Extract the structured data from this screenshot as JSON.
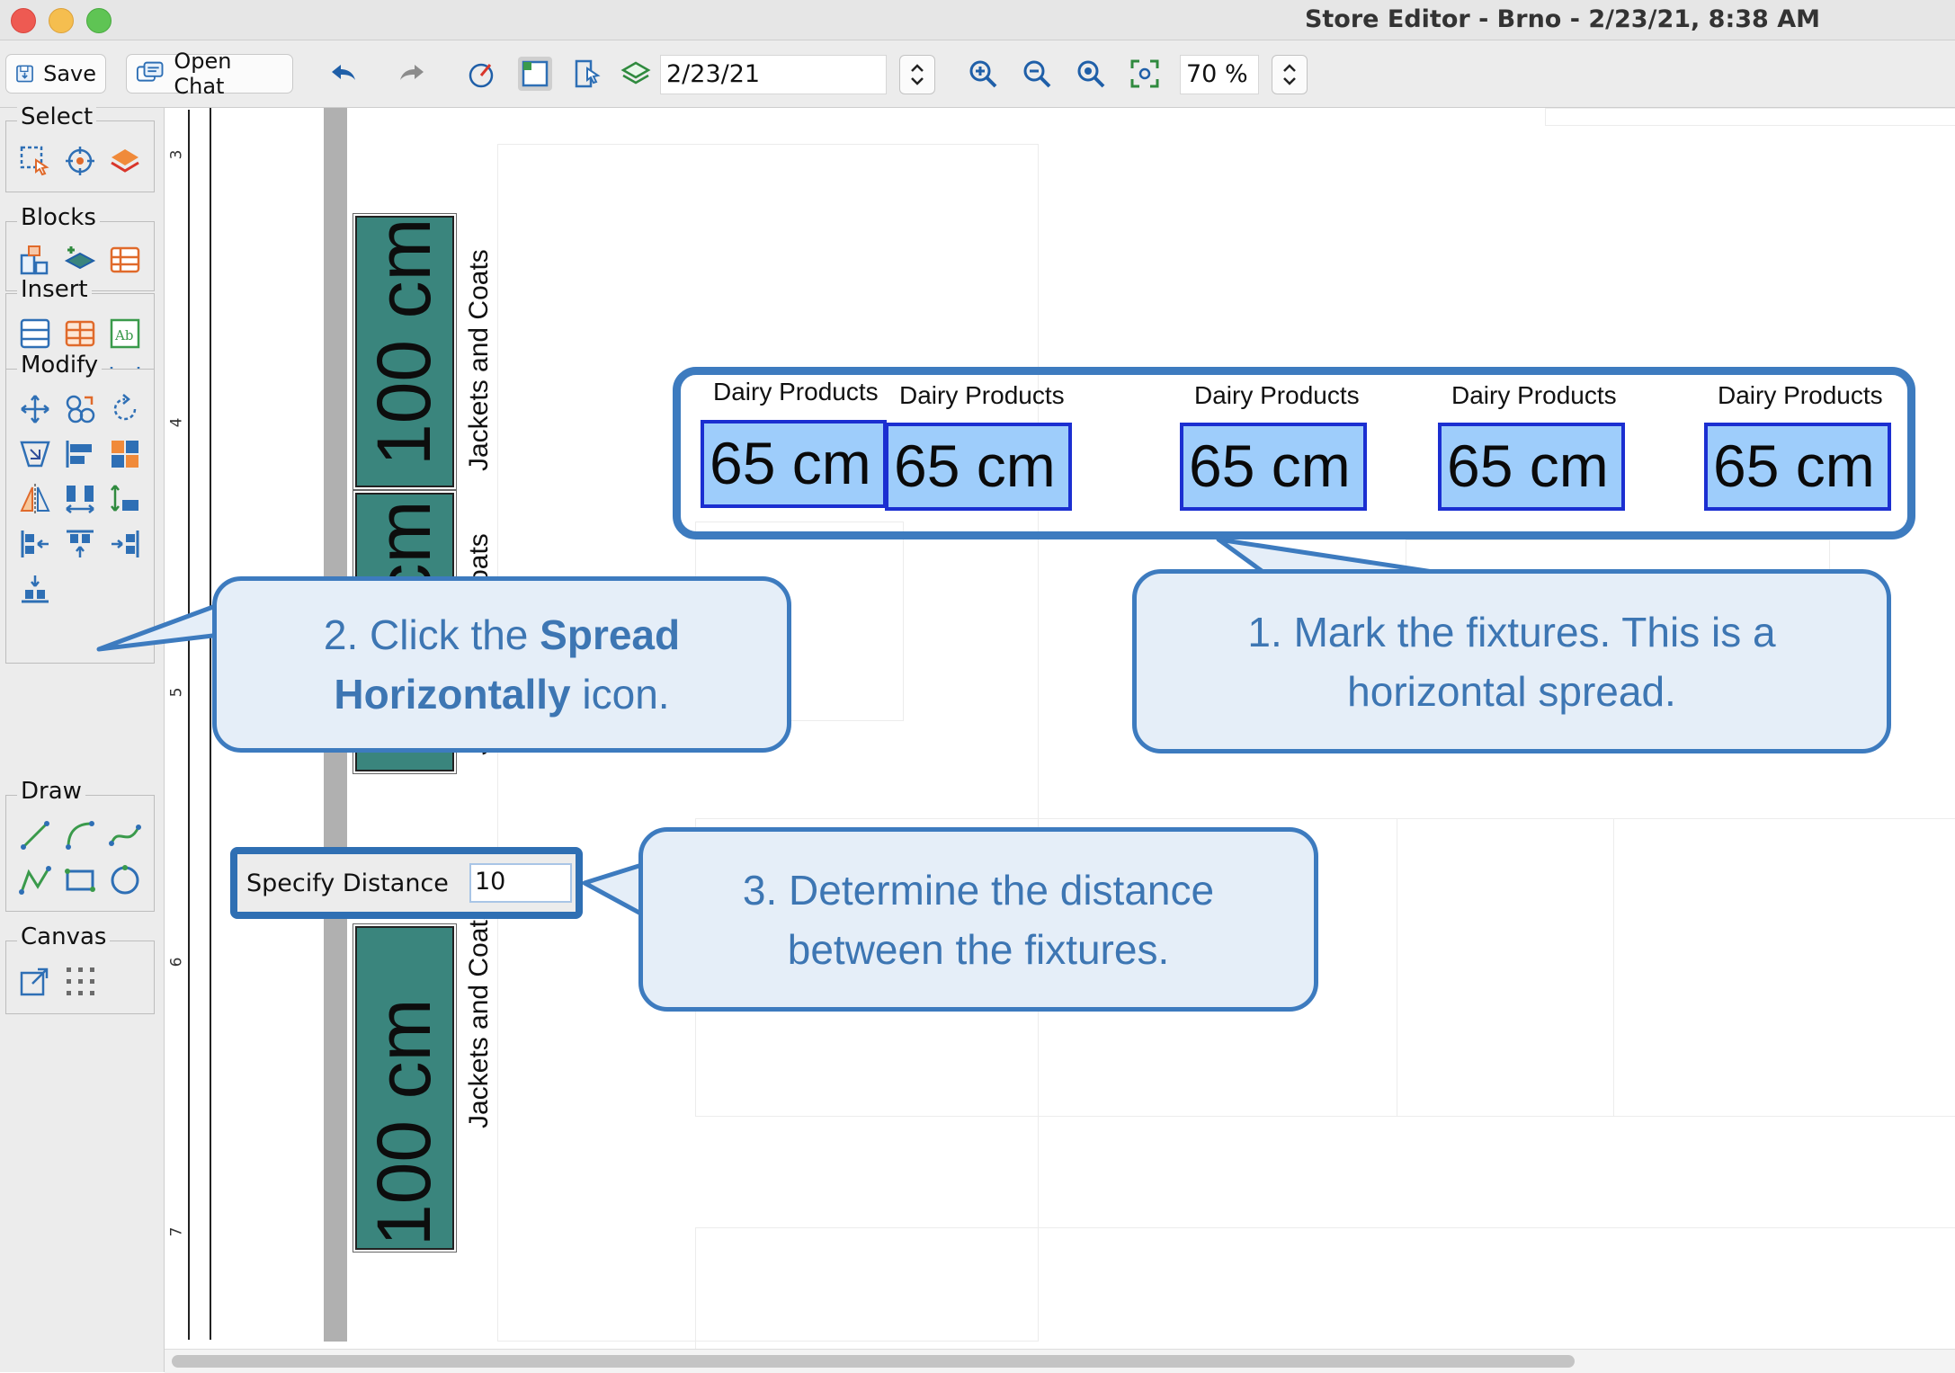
{
  "window": {
    "title": "Store Editor - Brno - 2/23/21, 8:38 AM"
  },
  "toolbar": {
    "save_label": "Save",
    "open_chat_label": "Open Chat",
    "date_value": "2/23/21",
    "zoom_value": "70 %"
  },
  "palette": {
    "select_label": "Select",
    "blocks_label": "Blocks",
    "insert_label": "Insert",
    "modify_label": "Modify",
    "draw_label": "Draw",
    "canvas_label": "Canvas"
  },
  "ruler": {
    "ticks": [
      "3",
      "4",
      "5",
      "6",
      "7"
    ]
  },
  "fixtures": {
    "jackets": [
      {
        "size": "100 cm",
        "label": "Jackets and Coats"
      },
      {
        "size": "100 cm",
        "label": "Jackets and Coats"
      },
      {
        "size": "100 cm",
        "label": "Jackets and Coats"
      }
    ],
    "dairy": [
      {
        "label": "Dairy Products",
        "size": "65 cm"
      },
      {
        "label": "Dairy Products",
        "size": "65 cm"
      },
      {
        "label": "Dairy Products",
        "size": "65 cm"
      },
      {
        "label": "Dairy Products",
        "size": "65 cm"
      },
      {
        "label": "Dairy Products",
        "size": "65 cm"
      }
    ]
  },
  "callouts": {
    "step1": {
      "line1": "1. Mark the fixtures. This is a",
      "line2": "horizontal spread."
    },
    "step2": {
      "prefix": "2. Click the ",
      "bold1": "Spread",
      "bold2": "Horizontally",
      "suffix": " icon."
    },
    "step3": {
      "line1": "3. Determine the distance",
      "line2": "between the fixtures."
    }
  },
  "specify": {
    "label": "Specify Distance",
    "value": "10"
  },
  "colors": {
    "callout_blue": "#3d7bbf",
    "callout_fill": "#e5eef8",
    "fixture_teal": "#3a857d",
    "selection_fill": "#9ecdfb",
    "selection_border": "#1b2fd1"
  }
}
